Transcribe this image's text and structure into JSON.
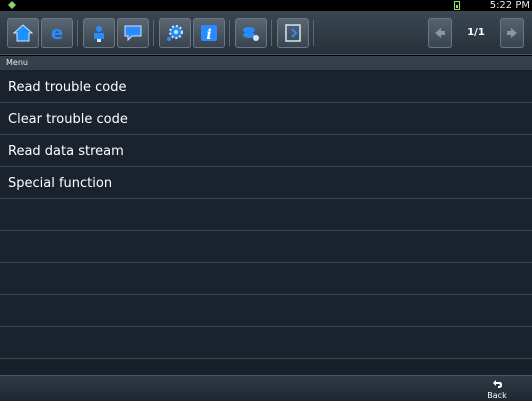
{
  "statusbar": {
    "time": "5:22 PM",
    "notification_icon": "android-notification-icon",
    "battery_icon": "battery-icon"
  },
  "toolbar": {
    "buttons": [
      {
        "name": "home-icon"
      },
      {
        "name": "browser-e-icon"
      },
      {
        "name": "vehicle-diagnostic-icon"
      },
      {
        "name": "chat-bubble-icon"
      },
      {
        "name": "settings-gear-icon"
      },
      {
        "name": "info-icon"
      },
      {
        "name": "data-tools-icon"
      },
      {
        "name": "exit-door-icon"
      }
    ],
    "pager": {
      "label": "1/1",
      "prev_icon": "arrow-left-icon",
      "next_icon": "arrow-right-icon"
    }
  },
  "menu": {
    "header": "Menu",
    "items": [
      {
        "label": "Read trouble code"
      },
      {
        "label": "Clear trouble code"
      },
      {
        "label": "Read data stream"
      },
      {
        "label": "Special function"
      },
      {
        "label": ""
      },
      {
        "label": ""
      },
      {
        "label": ""
      },
      {
        "label": ""
      },
      {
        "label": ""
      }
    ]
  },
  "bottom": {
    "back_label": "Back",
    "back_icon": "back-arrow-icon"
  },
  "colors": {
    "toolbar_bg": "#2e3944",
    "list_bg": "#1a232d",
    "row_divider": "#3c4752",
    "icon_blue": "#1e90ff"
  }
}
